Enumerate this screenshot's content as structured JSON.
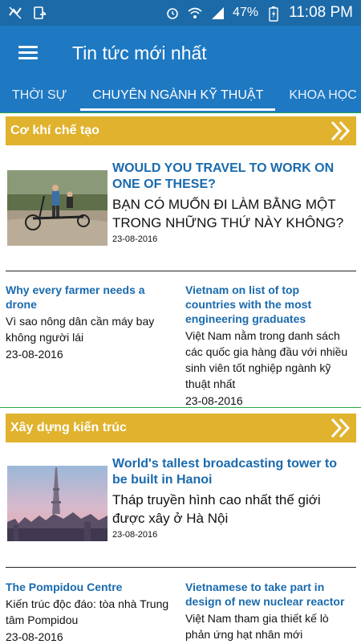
{
  "status": {
    "battery": "47%",
    "time": "11:08 PM"
  },
  "app": {
    "title": "Tin tức mới nhất"
  },
  "tabs": [
    {
      "label": "THỜI SỰ"
    },
    {
      "label": "CHUYÊN NGÀNH KỸ THUẬT"
    },
    {
      "label": "KHOA HỌC"
    }
  ],
  "sections": [
    {
      "title": "Cơ khí chế tạo",
      "featured": {
        "title": "WOULD YOU TRAVEL TO WORK ON ONE OF THESE?",
        "subtitle": "BẠN CÓ MUỐN ĐI LÀM BẰNG MỘT TRONG NHỮNG THỨ NÀY KHÔNG?",
        "date": "23-08-2016"
      },
      "items": [
        {
          "title": "Why every farmer needs a drone",
          "subtitle": "Vì sao nông dân cần máy bay không người lái",
          "date": "23-08-2016"
        },
        {
          "title": "Vietnam on list of top countries with the most engineering graduates",
          "subtitle": "Việt Nam nằm trong danh sách các quốc gia hàng đầu với nhiều sinh viên tốt nghiệp ngành kỹ thuật nhất",
          "date": "23-08-2016"
        }
      ]
    },
    {
      "title": "Xây dựng kiến trúc",
      "featured": {
        "title": "World's tallest broadcasting tower to be built in Hanoi",
        "subtitle": "Tháp truyền hình cao nhất thế giới được xây ở Hà Nội",
        "date": "23-08-2016"
      },
      "items": [
        {
          "title": "The Pompidou Centre",
          "subtitle": "Kiến trúc độc đáo: tòa nhà Trung tâm Pompidou",
          "date": "23-08-2016"
        },
        {
          "title": "Vietnamese to take part in design of new nuclear reactor",
          "subtitle": "Việt Nam tham gia thiết kế lò phản ứng hạt nhân mới",
          "date": ""
        }
      ]
    }
  ]
}
